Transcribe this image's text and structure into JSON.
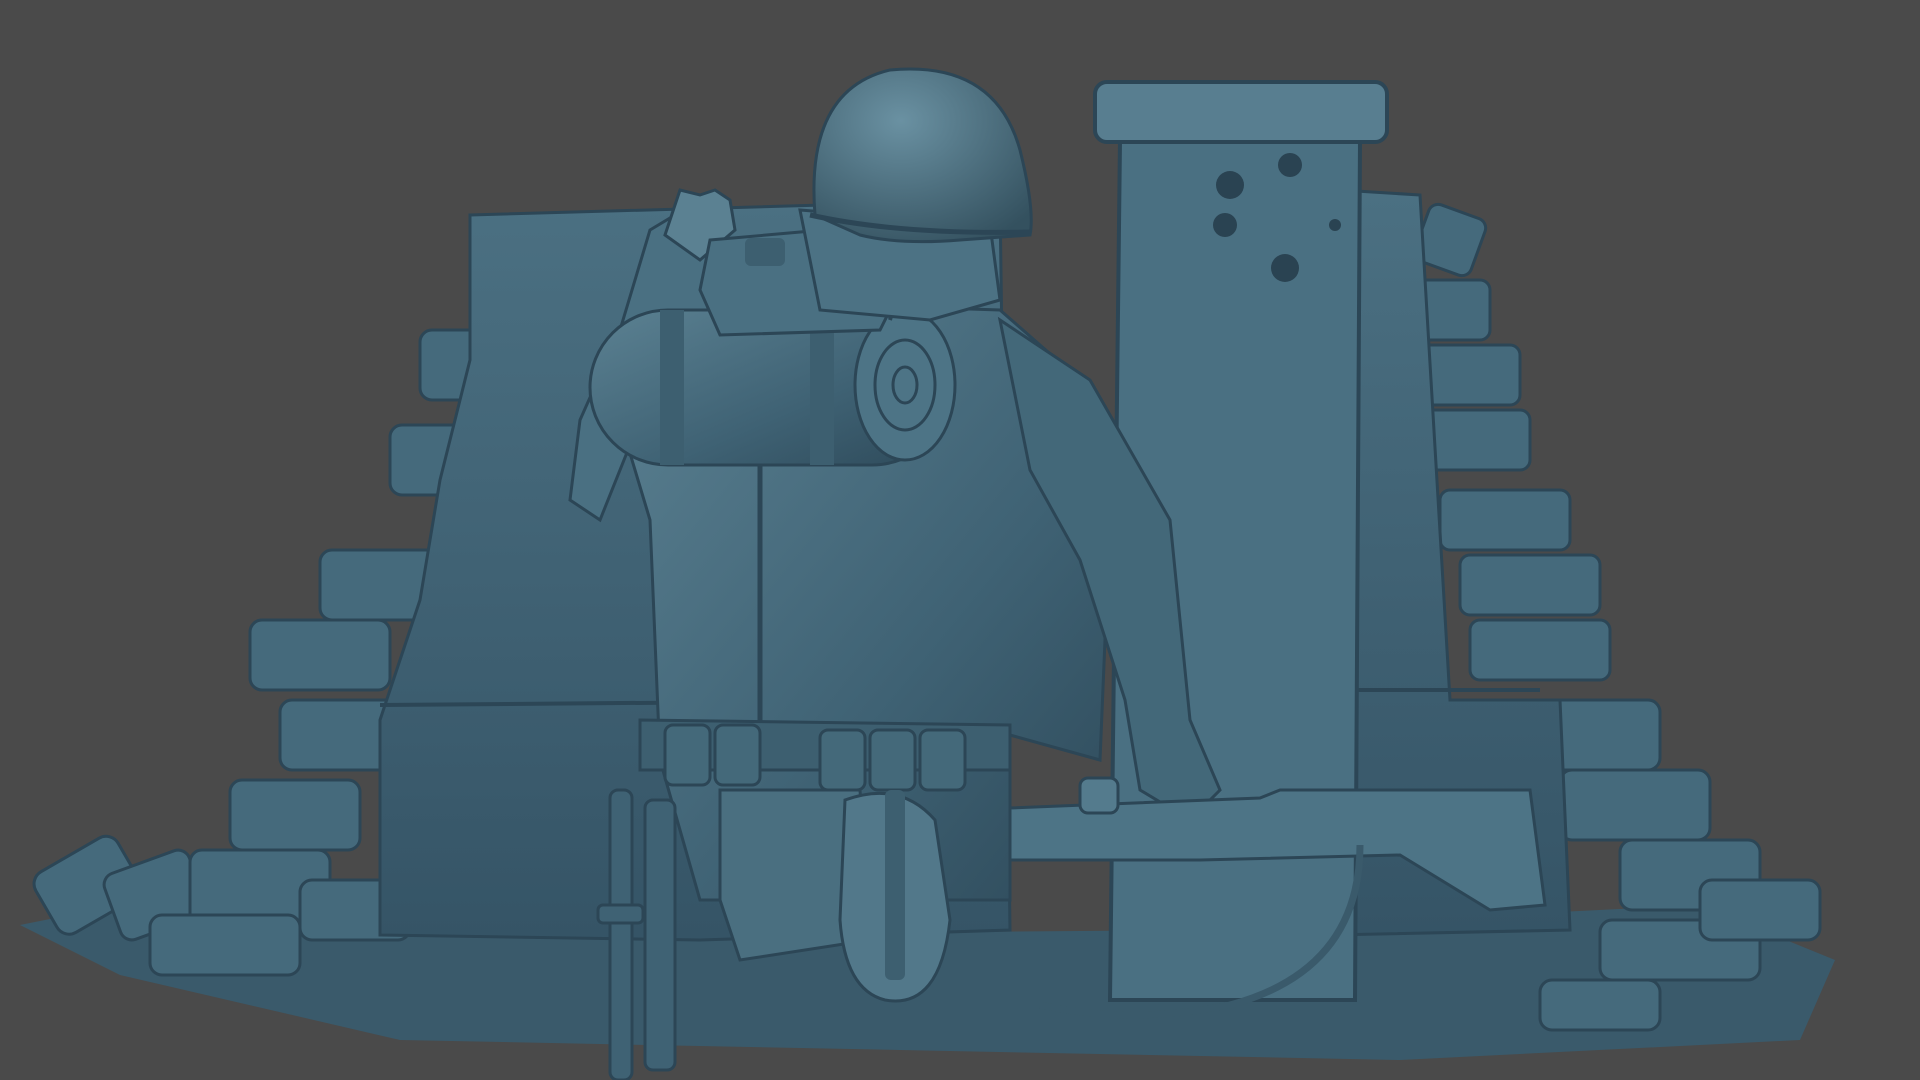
{
  "viewport": {
    "background": "#4a4a4a",
    "model_color": "#3f6274",
    "model_shadow": "#2c4656",
    "model_highlight": "#5f8596"
  }
}
